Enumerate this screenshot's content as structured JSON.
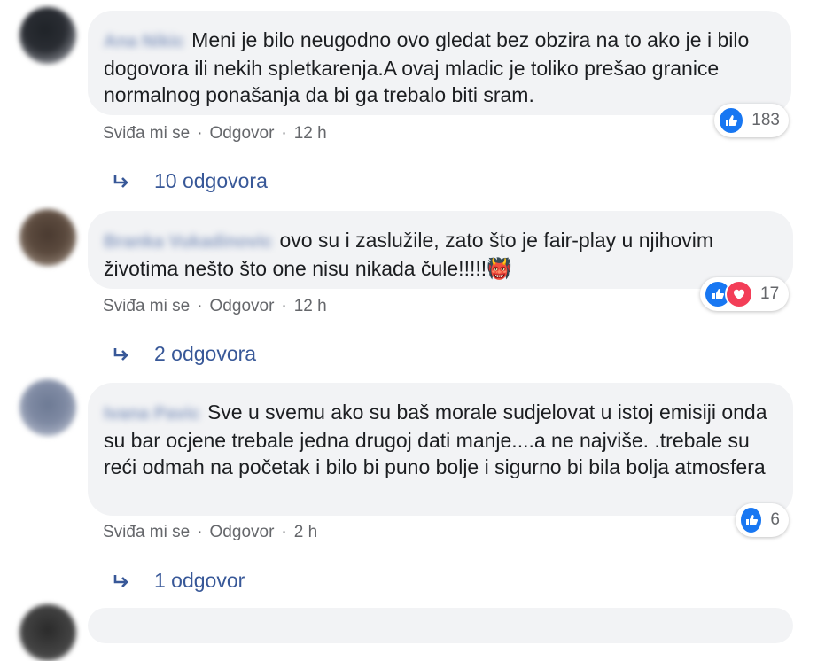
{
  "comments": [
    {
      "author": "Ana Nikic",
      "text": "Meni je bilo neugodno ovo gledat bez obzira na to ako je i bilo dogovora ili nekih spletkarenja.A ovaj mladic je toliko prešao granice normalnog ponašanja da bi ga trebalo biti sram.",
      "reaction_count": "183",
      "like_label": "Sviđa mi se",
      "reply_label": "Odgovor",
      "time": "12 h",
      "replies_label": "10 odgovora"
    },
    {
      "author": "Branka Vukadinovic",
      "text": "ovo su i zaslužile, zato što je fair-play u njihovim životima nešto što one nisu nikada čule!!!!!👹",
      "reaction_count": "17",
      "like_label": "Sviđa mi se",
      "reply_label": "Odgovor",
      "time": "12 h",
      "replies_label": "2 odgovora"
    },
    {
      "author": "Ivana Pavic",
      "text": "Sve u svemu ako su baš morale sudjelovat u istoj emisiji onda su bar ocjene trebale jedna drugoj dati manje....a ne najviše. .trebale su reći odmah na početak i bilo bi puno bolje i sigurno bi bila bolja atmosfera",
      "reaction_count": "6",
      "like_label": "Sviđa mi se",
      "reply_label": "Odgovor",
      "time": "2 h",
      "replies_label": "1 odgovor"
    }
  ],
  "separator": "·",
  "colors": {
    "bubble": "#f2f3f5",
    "link": "#385898",
    "meta": "#65676b",
    "like": "#1877f2",
    "love": "#f33e58"
  },
  "icons": {
    "like": "like-icon",
    "love": "love-icon",
    "reply_arrow": "reply-arrow-icon"
  }
}
